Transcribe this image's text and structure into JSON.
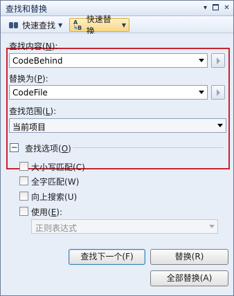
{
  "window": {
    "title": "查找和替换"
  },
  "titlebar_buttons": {
    "pin": "▾",
    "close": "✕"
  },
  "toolbar": {
    "quick_find": "快速查找",
    "quick_replace": "快速替换"
  },
  "find": {
    "label": "查找内容",
    "accel": "N",
    "value": "CodeBehind"
  },
  "replace": {
    "label": "替换为",
    "accel": "P",
    "value": "CodeFile"
  },
  "scope": {
    "label": "查找范围",
    "accel": "L",
    "value": "当前项目"
  },
  "options": {
    "header": "查找选项",
    "header_accel": "O",
    "collapse_glyph": "−",
    "items": [
      {
        "label": "大小写匹配",
        "accel": "C",
        "checked": false
      },
      {
        "label": "全字匹配",
        "accel": "W",
        "checked": false
      },
      {
        "label": "向上搜索",
        "accel": "U",
        "checked": false
      },
      {
        "label": "使用",
        "accel": "E",
        "checked": false
      }
    ],
    "regex_type": "正则表达式"
  },
  "buttons": {
    "find_next": "查找下一个(F)",
    "replace": "替换(R)",
    "replace_all": "全部替换(A)"
  },
  "colors": {
    "highlight_border": "#c8232f",
    "panel_bg": "#e7eef8"
  }
}
